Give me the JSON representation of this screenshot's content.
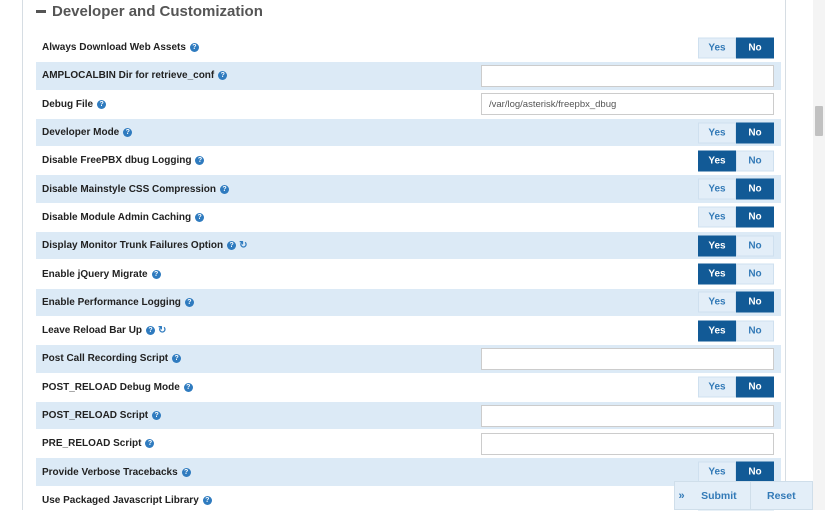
{
  "section": {
    "title": "Developer and Customization"
  },
  "toggle_labels": {
    "yes": "Yes",
    "no": "No"
  },
  "rows": [
    {
      "label": "Always Download Web Assets",
      "type": "toggle",
      "value": "No",
      "refresh": false
    },
    {
      "label": "AMPLOCALBIN Dir for retrieve_conf",
      "type": "input",
      "value": "",
      "refresh": false
    },
    {
      "label": "Debug File",
      "type": "input",
      "value": "/var/log/asterisk/freepbx_dbug",
      "refresh": false
    },
    {
      "label": "Developer Mode",
      "type": "toggle",
      "value": "No",
      "refresh": false
    },
    {
      "label": "Disable FreePBX dbug Logging",
      "type": "toggle",
      "value": "Yes",
      "refresh": false
    },
    {
      "label": "Disable Mainstyle CSS Compression",
      "type": "toggle",
      "value": "No",
      "refresh": false
    },
    {
      "label": "Disable Module Admin Caching",
      "type": "toggle",
      "value": "No",
      "refresh": false
    },
    {
      "label": "Display Monitor Trunk Failures Option",
      "type": "toggle",
      "value": "Yes",
      "refresh": true
    },
    {
      "label": "Enable jQuery Migrate",
      "type": "toggle",
      "value": "Yes",
      "refresh": false
    },
    {
      "label": "Enable Performance Logging",
      "type": "toggle",
      "value": "No",
      "refresh": false
    },
    {
      "label": "Leave Reload Bar Up",
      "type": "toggle",
      "value": "Yes",
      "refresh": true
    },
    {
      "label": "Post Call Recording Script",
      "type": "input",
      "value": "",
      "refresh": false
    },
    {
      "label": "POST_RELOAD Debug Mode",
      "type": "toggle",
      "value": "No",
      "refresh": false
    },
    {
      "label": "POST_RELOAD Script",
      "type": "input",
      "value": "",
      "refresh": false
    },
    {
      "label": "PRE_RELOAD Script",
      "type": "input",
      "value": "",
      "refresh": false
    },
    {
      "label": "Provide Verbose Tracebacks",
      "type": "toggle",
      "value": "No",
      "refresh": false
    },
    {
      "label": "Use Packaged Javascript Library",
      "type": "toggle",
      "value": "",
      "refresh": false
    }
  ],
  "actions": {
    "expand": "»",
    "submit": "Submit",
    "reset": "Reset"
  },
  "colors": {
    "row_shade": "#dceaf6",
    "toggle_active": "#125a96",
    "toggle_inactive": "#e3eef8",
    "link": "#337ab7"
  }
}
